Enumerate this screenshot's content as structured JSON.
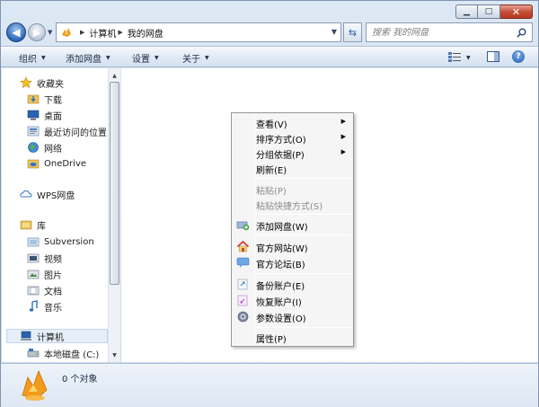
{
  "address": {
    "crumbs": [
      "计算机",
      "我的网盘"
    ]
  },
  "search": {
    "placeholder": "搜索 我的网盘"
  },
  "toolbar": {
    "organize": "组织",
    "add_disk": "添加网盘",
    "settings": "设置",
    "about": "关于"
  },
  "sidebar": {
    "favorites": "收藏夹",
    "downloads": "下载",
    "desktop": "桌面",
    "recent": "最近访问的位置",
    "network_fav": "网络",
    "onedrive": "OneDrive",
    "wps": "WPS网盘",
    "libraries": "库",
    "subversion": "Subversion",
    "videos": "视频",
    "pictures": "图片",
    "documents": "文档",
    "music": "音乐",
    "computer": "计算机",
    "local_disk": "本地磁盘 (C:)"
  },
  "context_menu": {
    "view": "查看(V)",
    "sort": "排序方式(O)",
    "group": "分组依据(P)",
    "refresh": "刷新(E)",
    "paste": "粘贴(P)",
    "paste_shortcut": "粘贴快捷方式(S)",
    "add_disk": "添加网盘(W)",
    "website": "官方网站(W)",
    "forum": "官方论坛(B)",
    "backup": "备份账户(E)",
    "restore": "恢复账户(I)",
    "params": "参数设置(O)",
    "properties": "属性(P)"
  },
  "status": {
    "count": "0 个对象"
  },
  "colors": {
    "accent": "#2c67b8",
    "close": "#c44a33",
    "selection": "#e6eef8"
  }
}
